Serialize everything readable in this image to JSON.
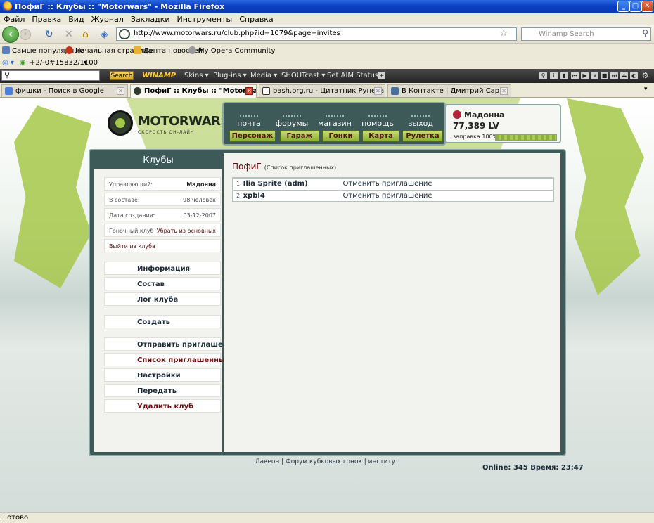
{
  "window": {
    "title": "ПофиГ :: Клубы :: \"Motorwars\" - Mozilla Firefox",
    "minimize": "_",
    "maximize": "□",
    "close": "✕"
  },
  "menu": [
    "Файл",
    "Правка",
    "Вид",
    "Журнал",
    "Закладки",
    "Инструменты",
    "Справка"
  ],
  "navbar": {
    "url": "http://www.motorwars.ru/club.php?id=1079&page=invites",
    "search_placeholder": "Winamp Search"
  },
  "bookmarks": [
    "Самые популярные",
    "Начальная страница",
    "Лента новостей",
    "My Opera Community"
  ],
  "toolrow": {
    "counter": "+2/-0",
    "rank": "#15832/1100"
  },
  "winamp": {
    "search_label": "Search",
    "logo": "WINAMP",
    "items": [
      "Skins",
      "Plug-ins",
      "Media",
      "SHOUTcast",
      "Set AIM Status"
    ]
  },
  "tabs": [
    {
      "label": "фишки - Поиск в Google",
      "active": false
    },
    {
      "label": "ПофиГ :: Клубы :: \"Motorwars\"",
      "active": true
    },
    {
      "label": "bash.org.ru - Цитатник Рунета",
      "active": false
    },
    {
      "label": "В Контакте | Дмитрий Сарки",
      "active": false
    }
  ],
  "site": {
    "logo": "MOTORWARS.RU",
    "logo_sub": "СКОРОСТЬ ОН-ЛАЙН",
    "nav": [
      "почта",
      "форумы",
      "магазин",
      "помощь",
      "выход"
    ],
    "buttons": [
      "Персонаж",
      "Гараж",
      "Гонки",
      "Карта",
      "Рулетка"
    ],
    "user": {
      "name": "Мадонна",
      "money": "77,389 LV",
      "fuel_label": "заправка 100%",
      "fuel_level": 1.0
    }
  },
  "club": {
    "section_title": "Клубы",
    "info": [
      {
        "key": "Управляющий:",
        "value": "Мадонна"
      },
      {
        "key": "В составе:",
        "value": "98 человек"
      },
      {
        "key": "Дата создания:",
        "value": "03-12-2007"
      },
      {
        "key": "Гоночный клуб",
        "value": "Убрать из основных"
      }
    ],
    "leave": "Выйти из клуба",
    "menu_group1": [
      "Информация",
      "Состав",
      "Лог клуба"
    ],
    "menu_group2": [
      "Создать"
    ],
    "menu_group3": [
      "Отправить приглашение",
      "Список приглашенных",
      "Настройки",
      "Передать",
      "Удалить клуб"
    ]
  },
  "main": {
    "heading": "ПофиГ",
    "subheading": "(Список приглашенных)",
    "invites": [
      {
        "num": "1.",
        "name": "Ilia Sprite (adm)",
        "action": "Отменить приглашение"
      },
      {
        "num": "2.",
        "name": "xpbl4",
        "action": "Отменить приглашение"
      }
    ]
  },
  "footer": {
    "links": [
      "Лавеон",
      "Форум кубковых гонок",
      "институт"
    ],
    "online": "Online: 345  Время: 23:47"
  },
  "status": "Готово",
  "colors": {
    "xp_blue": "#0a3fc4",
    "site_dark": "#3d5a59",
    "site_green": "#a6c84a",
    "link_red": "#6a0b0b"
  }
}
